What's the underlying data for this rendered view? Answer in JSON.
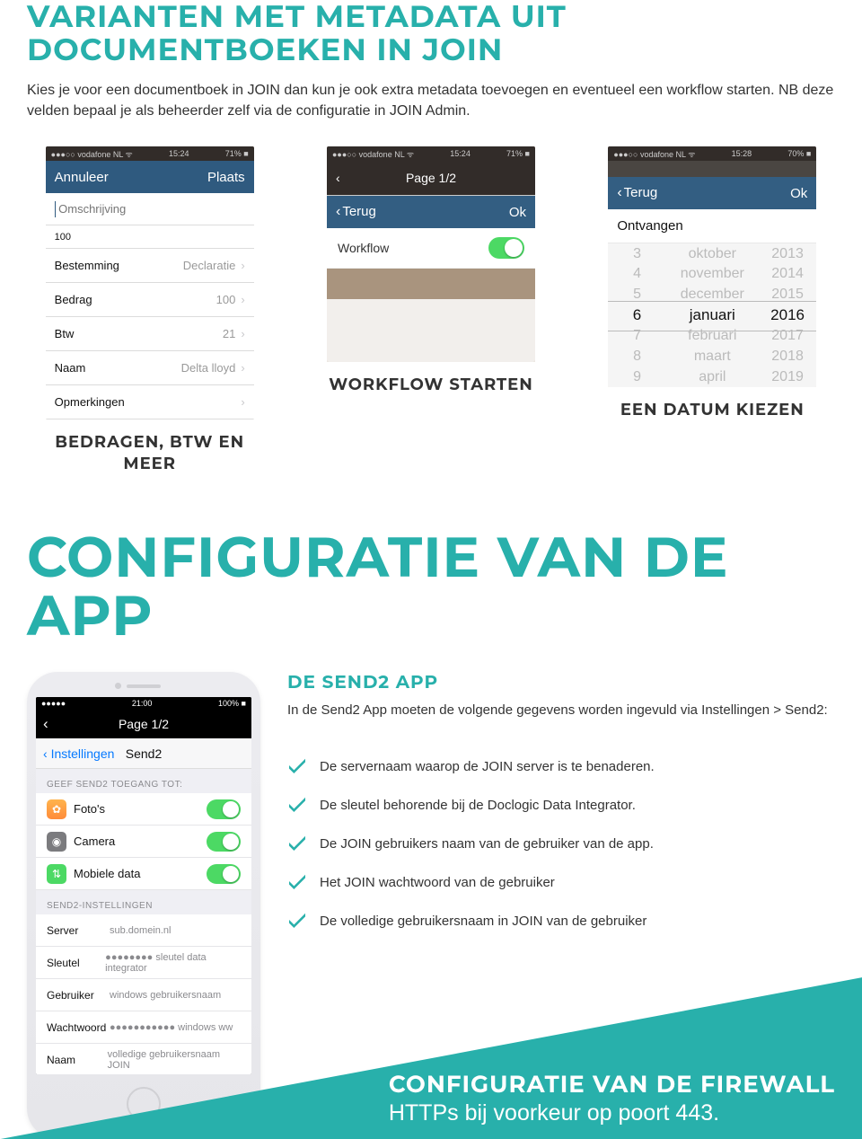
{
  "section1": {
    "title": "VARIANTEN MET METADATA UIT DOCUMENTBOEKEN IN JOIN",
    "intro": "Kies je voor een documentboek in JOIN dan kun je ook extra metadata toevoegen en eventueel een workflow starten. NB deze velden bepaal je als beheerder zelf via de configuratie in JOIN Admin."
  },
  "shots": {
    "s1": {
      "status_left": "●●●○○ vodafone NL ᯤ",
      "status_mid": "15:24",
      "status_right": "71% ■",
      "nav_left": "Annuleer",
      "nav_right": "Plaats",
      "placeholder": "Omschrijving",
      "rows": [
        {
          "label": "100",
          "val": "",
          "small": true
        },
        {
          "label": "Bestemming",
          "val": "Declaratie"
        },
        {
          "label": "Bedrag",
          "val": "100"
        },
        {
          "label": "Btw",
          "val": "21"
        },
        {
          "label": "Naam",
          "val": "Delta lloyd"
        },
        {
          "label": "Opmerkingen",
          "val": ""
        }
      ],
      "caption": "BEDRAGEN, BTW EN MEER"
    },
    "s2": {
      "status_left": "●●●○○ vodafone NL ᯤ",
      "status_mid": "15:24",
      "status_right": "71% ■",
      "page_title": "Page 1/2",
      "sheet_back": "Terug",
      "sheet_ok": "Ok",
      "sheet_label": "Workflow",
      "caption": "WORKFLOW STARTEN"
    },
    "s3": {
      "status_left": "●●●○○ vodafone NL ᯤ",
      "status_mid": "15:28",
      "status_right": "70% ■",
      "hdr_back": "Terug",
      "hdr_ok": "Ok",
      "date_title": "Ontvangen",
      "days": [
        "3",
        "4",
        "5",
        "6",
        "7",
        "8",
        "9"
      ],
      "months": [
        "oktober",
        "november",
        "december",
        "januari",
        "februari",
        "maart",
        "april"
      ],
      "years": [
        "2013",
        "2014",
        "2015",
        "2016",
        "2017",
        "2018",
        "2019"
      ],
      "sel_index": 3,
      "caption": "EEN DATUM KIEZEN"
    }
  },
  "section2": {
    "title": "CONFIGURATIE VAN DE APP",
    "sub_title": "DE SEND2 APP",
    "sub_text": "In de Send2 App moeten de volgende gegevens worden ingevuld via Instellingen > Send2:",
    "checks": [
      "De servernaam waarop de JOIN server is te benaderen.",
      "De sleutel behorende bij de Doclogic Data Integrator.",
      "De JOIN gebruikers naam van de gebruiker van de app.",
      "Het JOIN wachtwoord van de gebruiker",
      "De volledige gebruikersnaam in JOIN van de gebruiker"
    ]
  },
  "phone": {
    "status_mid": "21:00",
    "status_right": "100% ■",
    "nav_title": "Page 1/2",
    "subnav_back": "Instellingen",
    "subnav_title": "Send2",
    "grp1": "GEEF SEND2 TOEGANG TOT:",
    "access": [
      {
        "icon": "g1",
        "glyph": "✿",
        "label": "Foto's"
      },
      {
        "icon": "g2",
        "glyph": "◉",
        "label": "Camera"
      },
      {
        "icon": "g3",
        "glyph": "⇅",
        "label": "Mobiele data"
      }
    ],
    "grp2": "SEND2-INSTELLINGEN",
    "kv": [
      {
        "k": "Server",
        "v": "sub.domein.nl"
      },
      {
        "k": "Sleutel",
        "v": "●●●●●●●● sleutel data integrator"
      },
      {
        "k": "Gebruiker",
        "v": "windows gebruikersnaam"
      },
      {
        "k": "Wachtwoord",
        "v": "●●●●●●●●●●● windows ww"
      },
      {
        "k": "Naam",
        "v": "volledige gebruikersnaam JOIN"
      }
    ]
  },
  "footer": {
    "t1": "CONFIGURATIE VAN DE FIREWALL",
    "t2": "HTTPs bij voorkeur op poort 443."
  }
}
